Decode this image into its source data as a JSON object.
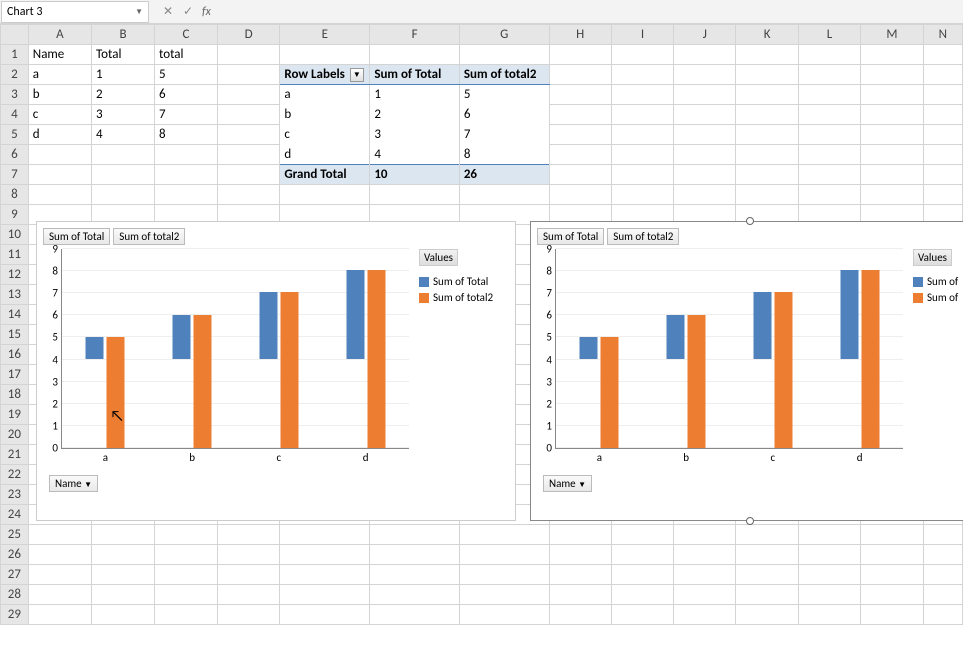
{
  "name_box": "Chart 3",
  "fx_label": "fx",
  "columns": [
    "A",
    "B",
    "C",
    "D",
    "E",
    "F",
    "G",
    "H",
    "I",
    "J",
    "K",
    "L",
    "M",
    "N"
  ],
  "rows_visible": 29,
  "sheet": {
    "headers": {
      "A1": "Name",
      "B1": "Total",
      "C1": "total"
    },
    "data": [
      {
        "name": "a",
        "total": 1,
        "total2": 5
      },
      {
        "name": "b",
        "total": 2,
        "total2": 6
      },
      {
        "name": "c",
        "total": 3,
        "total2": 7
      },
      {
        "name": "d",
        "total": 4,
        "total2": 8
      }
    ]
  },
  "pivot": {
    "row_label_hdr": "Row Labels",
    "col1": "Sum of Total",
    "col2": "Sum of total2",
    "rows": [
      {
        "label": "a",
        "v1": 1,
        "v2": 5
      },
      {
        "label": "b",
        "v1": 2,
        "v2": 6
      },
      {
        "label": "c",
        "v1": 3,
        "v2": 7
      },
      {
        "label": "d",
        "v1": 4,
        "v2": 8
      }
    ],
    "grand_label": "Grand Total",
    "grand_v1": 10,
    "grand_v2": 26
  },
  "chart_data": [
    {
      "type": "bar",
      "categories": [
        "a",
        "b",
        "c",
        "d"
      ],
      "series": [
        {
          "name": "Sum of Total",
          "values": [
            1,
            2,
            3,
            4
          ],
          "color": "#4f81bd"
        },
        {
          "name": "Sum of total2",
          "values": [
            5,
            6,
            7,
            8
          ],
          "color": "#ed7d31"
        }
      ],
      "ylim": [
        0,
        9
      ],
      "ytick_step": 1,
      "legend_title": "Values",
      "field_buttons": [
        "Sum of Total",
        "Sum of total2"
      ],
      "axis_button": "Name"
    },
    {
      "type": "bar",
      "categories": [
        "a",
        "b",
        "c",
        "d"
      ],
      "series": [
        {
          "name": "Sum of Total",
          "values": [
            1,
            2,
            3,
            4
          ],
          "color": "#4f81bd"
        },
        {
          "name": "Sum of total2",
          "values": [
            5,
            6,
            7,
            8
          ],
          "color": "#ed7d31"
        }
      ],
      "ylim": [
        0,
        9
      ],
      "ytick_step": 1,
      "legend_title": "Values",
      "legend_items": [
        "Sum of",
        "Sum of"
      ],
      "field_buttons": [
        "Sum of Total",
        "Sum of total2"
      ],
      "axis_button": "Name",
      "selected": true
    }
  ]
}
